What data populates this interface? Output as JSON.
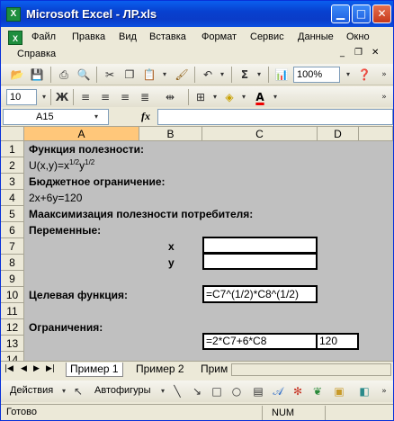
{
  "window": {
    "title": "Microsoft Excel - ЛР.xls",
    "app_icon": "X"
  },
  "menu": {
    "items": [
      "Файл",
      "Правка",
      "Вид",
      "Вставка",
      "Формат",
      "Сервис",
      "Данные",
      "Окно"
    ],
    "help": "Справка",
    "type_question": "",
    "close_doc_label": "✕"
  },
  "toolbar": {
    "zoom": "100%",
    "font_size": "10",
    "bold_label": "Ж"
  },
  "formula_bar": {
    "name_box": "A15",
    "fx_label": "fx",
    "formula": ""
  },
  "columns": [
    "A",
    "B",
    "C",
    "D"
  ],
  "rows": [
    "1",
    "2",
    "3",
    "4",
    "5",
    "6",
    "7",
    "8",
    "9",
    "10",
    "11",
    "12",
    "13",
    "14"
  ],
  "cells": {
    "a1": "Функция полезности:",
    "a2_prefix": "U(x,y)=x",
    "a2_sup1": "1/2",
    "a2_mid": "y",
    "a2_sup2": "1/2",
    "a3": "Бюджетное ограничение:",
    "a4": "2x+6y=120",
    "a5": "Маaксимизация полезности потребителя:",
    "a6": "Переменные:",
    "b7": "x",
    "b8": "y",
    "a10": "Целевая функция:",
    "c10": "=C7^(1/2)*C8^(1/2)",
    "a12": "Ограничения:",
    "c13": "=2*C7+6*C8",
    "d13": "120"
  },
  "sheets": [
    "Пример 1",
    "Пример 2",
    "Прим"
  ],
  "draw_toolbar": {
    "actions": "Действия",
    "autoshapes": "Автофигуры"
  },
  "status": {
    "ready": "Готово",
    "num": "NUM"
  },
  "colors": {
    "title_bar": "#0A3CC8",
    "grid_bg": "#C0C0C0",
    "selected_header": "#FFC77A"
  }
}
